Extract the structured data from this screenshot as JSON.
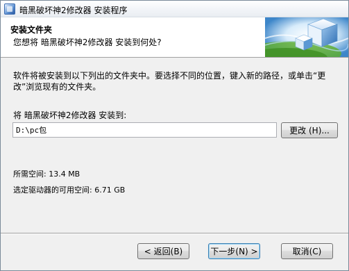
{
  "window": {
    "title": "暗黑破坏神2修改器 安装程序"
  },
  "header": {
    "title": "安装文件夹",
    "subtitle": "您想将 暗黑破坏神2修改器 安装到何处?"
  },
  "body": {
    "description": "软件将被安装到以下列出的文件夹中。要选择不同的位置，键入新的路径，或单击“更改”浏览现有的文件夹。",
    "install_label": "将 暗黑破坏神2修改器 安装到:",
    "path_value": "D:\\pc包",
    "browse_label": "更改 (H)...",
    "space_required": "所需空间: 13.4 MB",
    "space_available": "选定驱动器的可用空间: 6.71 GB"
  },
  "footer": {
    "back_label": "< 返回(B)",
    "next_label": "下一步(N) >",
    "cancel_label": "取消(C)"
  },
  "icons": {
    "app": "installer-icon",
    "banner": "install-folder-cubes-graphic"
  },
  "colors": {
    "header_bg": "#ffffff",
    "window_bg": "#f0f0f0",
    "banner_blue": "#2a6fb7",
    "banner_green": "#63b33a"
  }
}
